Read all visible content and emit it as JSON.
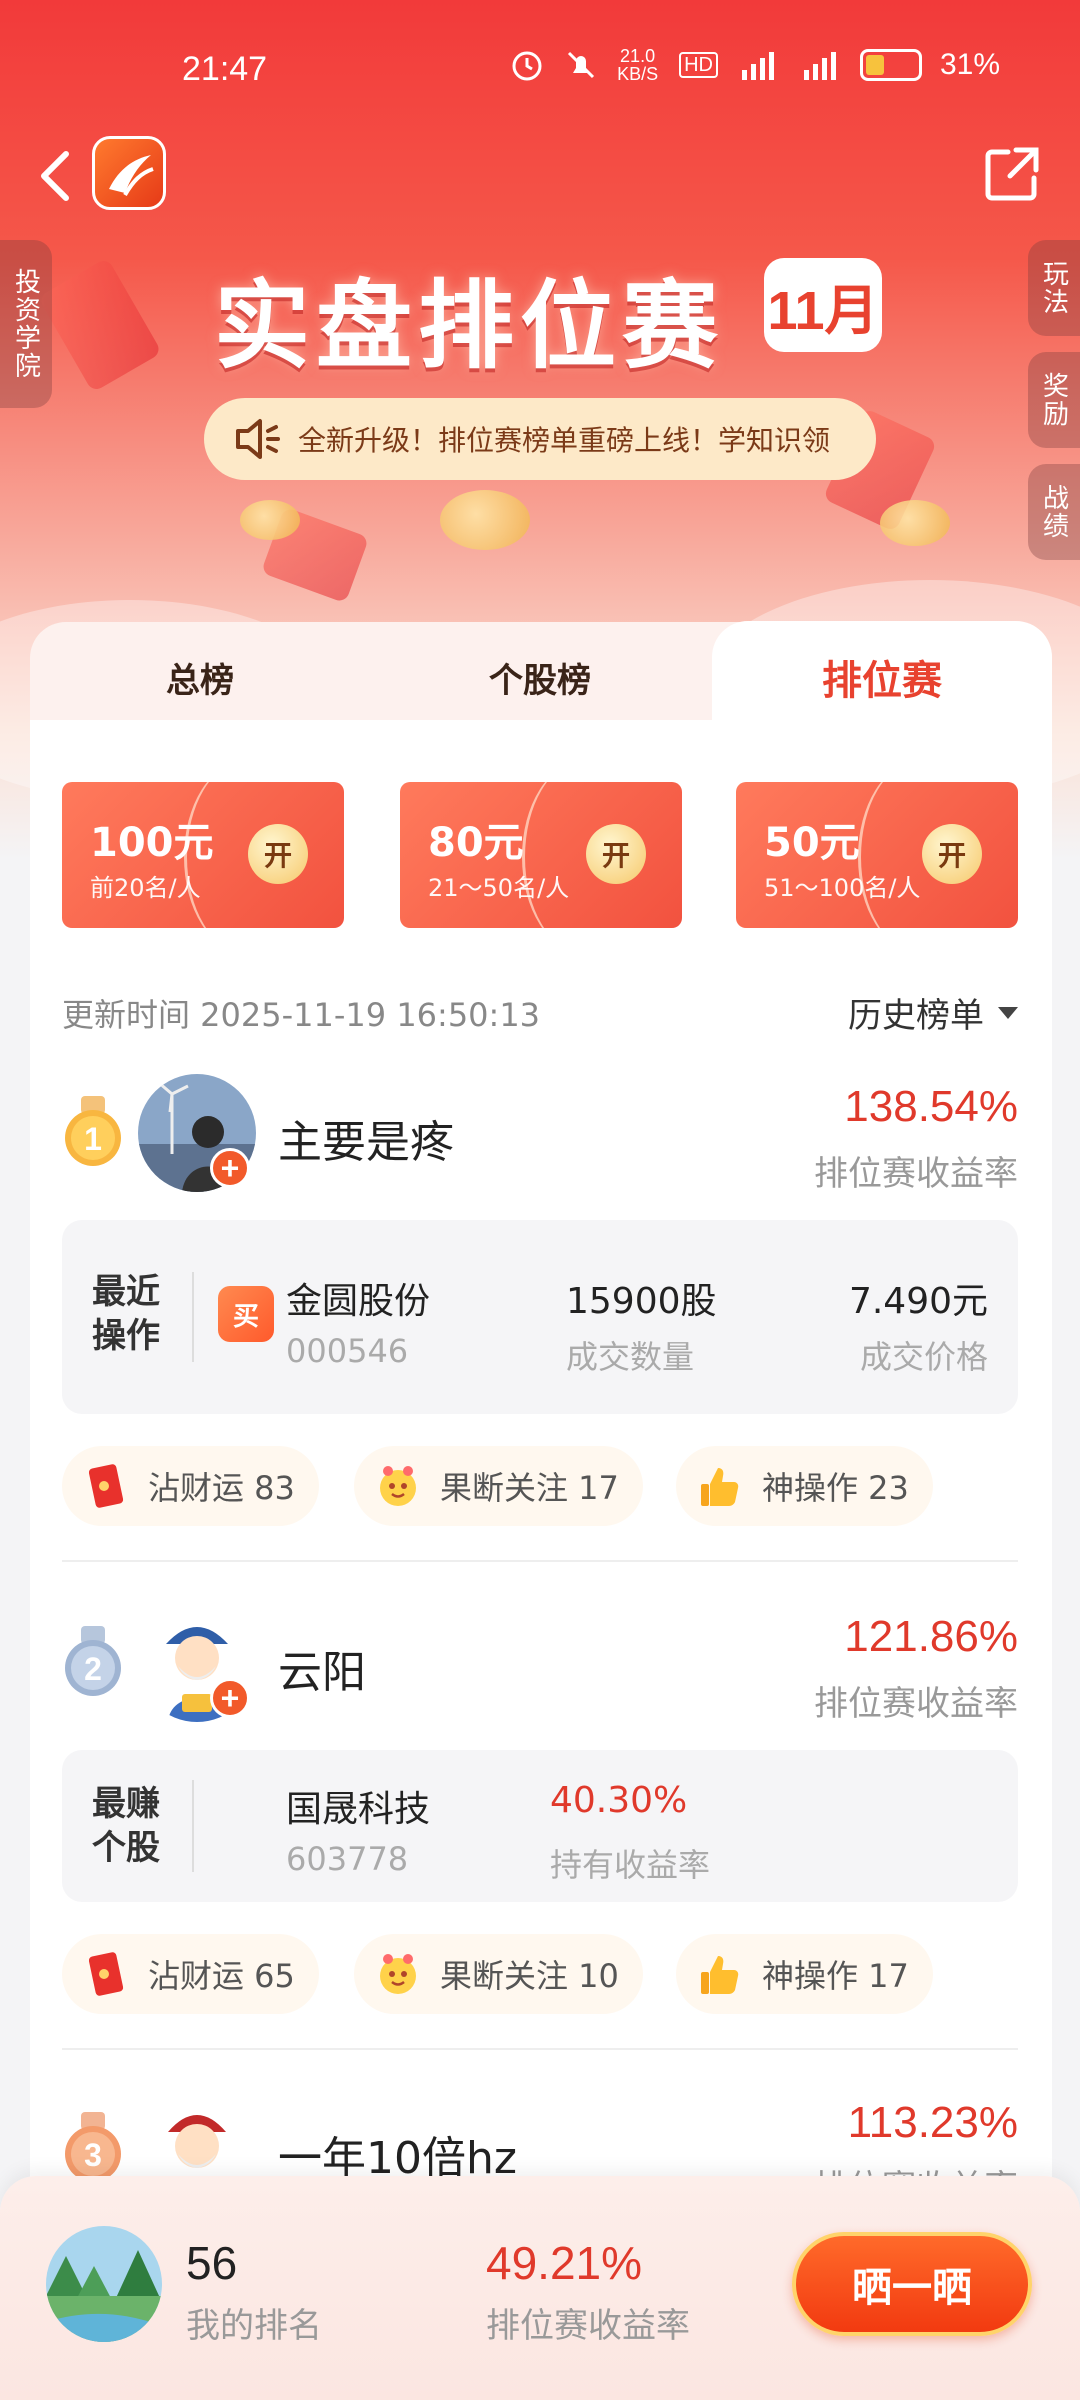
{
  "status_bar": {
    "time": "21:47",
    "net_speed": "21.0\nKB/S",
    "hd": "HD",
    "sig1": "5G",
    "sig2": "5G",
    "battery": "31%"
  },
  "side": {
    "left": "投资学院",
    "right1": "玩法",
    "right2": "奖励",
    "right3": "战绩"
  },
  "banner": {
    "title": "实盘排位赛",
    "month": "11月",
    "notice": "全新升级！排位赛榜单重磅上线！学知识领"
  },
  "tabs": [
    "总榜",
    "个股榜",
    "排位赛"
  ],
  "prizes": [
    {
      "amount": "100元",
      "desc": "前20名/人",
      "open": "开"
    },
    {
      "amount": "80元",
      "desc": "21～50名/人",
      "open": "开"
    },
    {
      "amount": "50元",
      "desc": "51～100名/人",
      "open": "开"
    }
  ],
  "update_time": "更新时间 2025-11-19 16:50:13",
  "history_label": "历史榜单",
  "ranks": [
    {
      "medal": "1",
      "name": "主要是疼",
      "rate": "138.54%",
      "rate_label": "排位赛收益率",
      "op_tag": "最近操作",
      "badge": "买",
      "stock": "金圆股份",
      "code": "000546",
      "col2_value": "15900股",
      "col2_label": "成交数量",
      "col3_value": "7.490元",
      "col3_label": "成交价格",
      "chips": [
        "沾财运 83",
        "果断关注 17",
        "神操作 23"
      ]
    },
    {
      "medal": "2",
      "name": "云阳",
      "rate": "121.86%",
      "rate_label": "排位赛收益率",
      "op_tag": "最赚个股",
      "stock": "国晟科技",
      "code": "603778",
      "col2_value": "40.30%",
      "col2_label": "持有收益率",
      "chips": [
        "沾财运 65",
        "果断关注 10",
        "神操作 17"
      ]
    },
    {
      "medal": "3",
      "name": "一年10倍hz",
      "rate": "113.23%",
      "rate_label": "排位赛收益率"
    }
  ],
  "me": {
    "rank": "56",
    "rank_label": "我的排名",
    "rate": "49.21%",
    "rate_label": "排位赛收益率",
    "share_button": "晒一晒"
  },
  "colors": {
    "accent_red": "#e0392b",
    "header_red": "#f23a3a",
    "orange": "#f25a2a"
  },
  "icons": [
    "back-icon",
    "app-logo-icon",
    "share-icon",
    "speaker-icon",
    "red-envelope-icon",
    "lucky-doll-icon",
    "thumbs-up-icon",
    "medal-icon",
    "dropdown-icon"
  ]
}
